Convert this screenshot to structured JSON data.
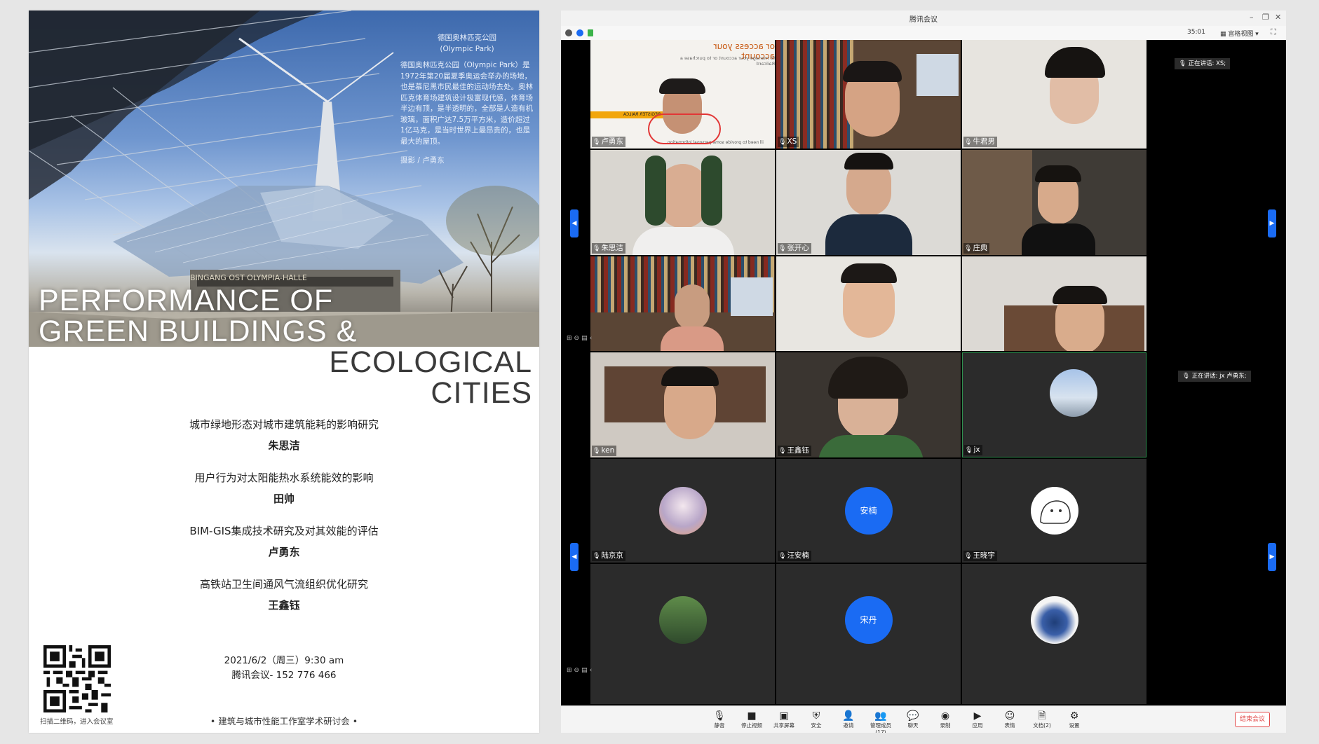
{
  "poster": {
    "photo_caption": {
      "title_cn": "德国奥林匹克公园",
      "title_en": "(Olympic Park)",
      "body": "德国奥林匹克公园（Olympic Park）是1972年第20届夏季奥运会举办的场地，也是慕尼黑市民最佳的运动场去处。奥林匹克体育场建筑设计极富现代感，体育场半边有顶，是半透明的，全部是人造有机玻璃，面积广达7.5万平方米，造价超过1亿马克，是当时世界上最昂贵的，也是最大的屋顶。",
      "credit": "摄影 / 卢勇东"
    },
    "sign_text": "BINGANG OST OLYMPIA-HALLE",
    "title_line1": "PERFORMANCE OF",
    "title_line2": "GREEN BUILDINGS &",
    "title_line3": "ECOLOGICAL",
    "title_line4": "CITIES",
    "talks": [
      {
        "title": "城市绿地形态对城市建筑能耗的影响研究",
        "speaker": "朱思洁"
      },
      {
        "title": "用户行为对太阳能热水系统能效的影响",
        "speaker": "田帅"
      },
      {
        "title": "BIM-GIS集成技术研究及对其效能的评估",
        "speaker": "卢勇东"
      },
      {
        "title": "高铁站卫生间通风气流组织优化研究",
        "speaker": "王鑫钰"
      }
    ],
    "datetime": "2021/6/2（周三）9:30 am",
    "meeting_id": "腾讯会议- 152 776 466",
    "qr_caption": "扫描二维码，进入会议室",
    "seminar": "• 建筑与城市性能工作室学术研讨会 •"
  },
  "meeting": {
    "window_title": "腾讯会议",
    "timer": "35:01",
    "view_label": "宫格视图",
    "speaking_label_1": "正在讲话: XS;",
    "speaking_label_2": "正在讲话: jx 卢勇东;",
    "shared_screen_text": "or access your account",
    "shared_screen_sub": "to manage your account or to purchase a Railcard",
    "shared_screen_bar": "REGISTER RAILCA",
    "shared_screen_note": "ill need to provide some personal information",
    "participants": [
      {
        "name": "卢勇东"
      },
      {
        "name": "XS"
      },
      {
        "name": "牛君男"
      },
      {
        "name": "朱思洁"
      },
      {
        "name": "张开心"
      },
      {
        "name": "庄典"
      },
      {
        "name": ""
      },
      {
        "name": ""
      },
      {
        "name": ""
      },
      {
        "name": "ken"
      },
      {
        "name": "王鑫钰"
      },
      {
        "name": "jx"
      },
      {
        "name": "陆京京"
      },
      {
        "name": "汪安楠",
        "avatar_text": "安楠"
      },
      {
        "name": "王晓宇"
      },
      {
        "name": ""
      },
      {
        "name": "",
        "avatar_text": "宋丹"
      },
      {
        "name": ""
      }
    ],
    "toolbar": [
      {
        "icon": "mic-icon",
        "label": "静音"
      },
      {
        "icon": "video-icon",
        "label": "停止视频"
      },
      {
        "icon": "share-screen-icon",
        "label": "共享屏幕"
      },
      {
        "icon": "shield-icon",
        "label": "安全"
      },
      {
        "icon": "invite-icon",
        "label": "邀请"
      },
      {
        "icon": "manage-members-icon",
        "label": "管理成员(17)"
      },
      {
        "icon": "chat-icon",
        "label": "聊天"
      },
      {
        "icon": "record-icon",
        "label": "录制"
      },
      {
        "icon": "apps-icon",
        "label": "应用"
      },
      {
        "icon": "emoji-icon",
        "label": "表情"
      },
      {
        "icon": "document-icon",
        "label": "文档(2)"
      },
      {
        "icon": "settings-icon",
        "label": "设置"
      }
    ],
    "end_label": "结束会议"
  }
}
